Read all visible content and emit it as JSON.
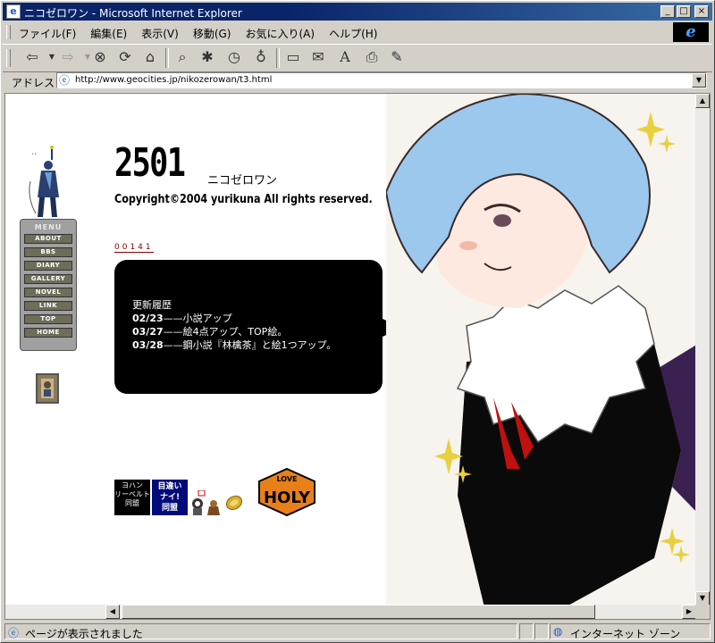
{
  "window": {
    "title": "ニコゼロワン - Microsoft Internet Explorer",
    "min_glyph": "_",
    "max_glyph": "□",
    "close_glyph": "×",
    "ie_glyph": "e"
  },
  "menubar": {
    "items": [
      "ファイル(F)",
      "編集(E)",
      "表示(V)",
      "移動(G)",
      "お気に入り(A)",
      "ヘルプ(H)"
    ]
  },
  "toolbar": {
    "buttons": [
      {
        "name": "back",
        "glyph": "⇦"
      },
      {
        "name": "forward",
        "glyph": "⇨"
      },
      {
        "name": "stop",
        "glyph": "⊗"
      },
      {
        "name": "refresh",
        "glyph": "⟳"
      },
      {
        "name": "home",
        "glyph": "⌂"
      },
      {
        "name": "search",
        "glyph": "⌕"
      },
      {
        "name": "favorites",
        "glyph": "✱"
      },
      {
        "name": "history",
        "glyph": "◷"
      },
      {
        "name": "channels",
        "glyph": "♁"
      },
      {
        "name": "fullscreen",
        "glyph": "▭"
      },
      {
        "name": "mail",
        "glyph": "✉"
      },
      {
        "name": "font",
        "glyph": "A"
      },
      {
        "name": "print",
        "glyph": "⎙"
      },
      {
        "name": "edit",
        "glyph": "✎"
      }
    ]
  },
  "address": {
    "label": "アドレス",
    "url": "http://www.geocities.jp/nikozerowan/t3.html"
  },
  "page": {
    "logo_number": "2501",
    "logo_kana": "ニコゼロワン",
    "copyright": "Copyright©2004 yurikuna All rights reserved.",
    "counter": "00141",
    "news_title": "更新履歴",
    "news": [
      {
        "date": "02/23",
        "text": "——小説アップ"
      },
      {
        "date": "03/27",
        "text": "——絵4点アップ、TOP絵。"
      },
      {
        "date": "03/28",
        "text": "——鋼小説『林檎茶』と絵1つアップ。"
      }
    ],
    "menu_title": "MENU",
    "menu": [
      "ABOUT",
      "BBS",
      "DIARY",
      "GALLERY",
      "NOVEL",
      "LINK",
      "TOP",
      "HOME"
    ],
    "banner1": [
      "ヨハン",
      "リーベルト",
      "同盟"
    ],
    "banner2": [
      "目違い",
      "ナイ!",
      "同盟"
    ],
    "holy_top": "LOVE",
    "holy_main": "HOLY"
  },
  "status": {
    "text": "ページが表示されました",
    "zone": "インターネット ゾーン"
  }
}
